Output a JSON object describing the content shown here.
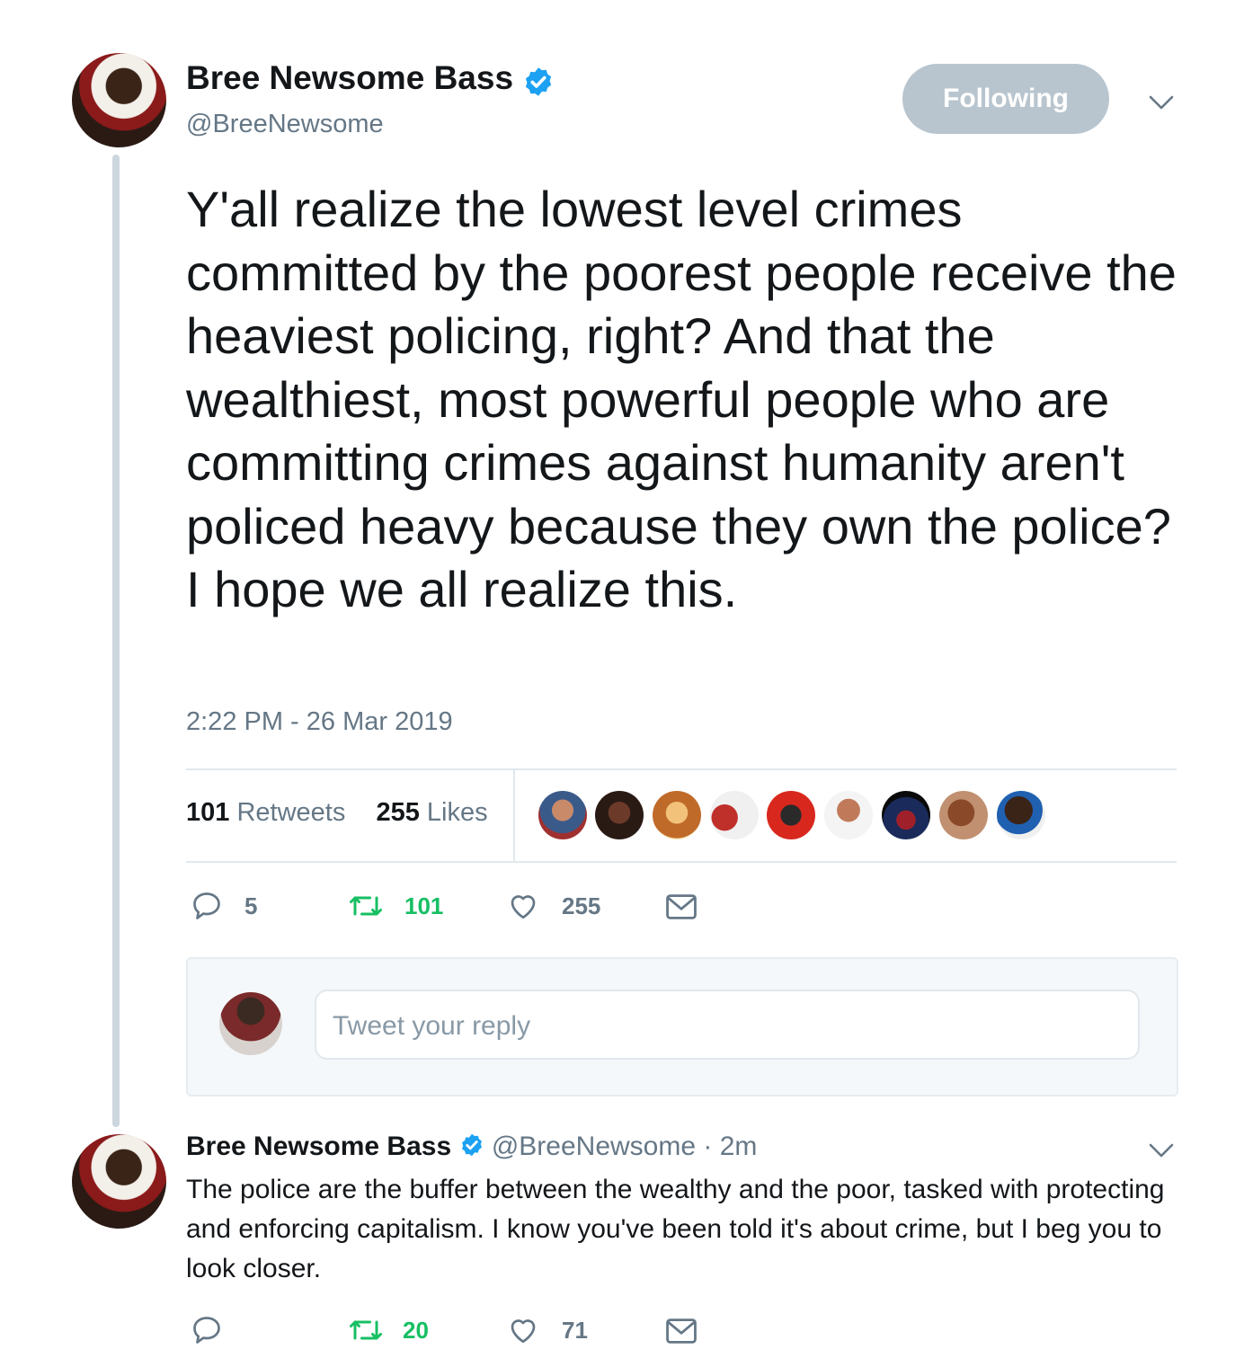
{
  "main_tweet": {
    "author_name": "Bree Newsome Bass",
    "author_handle": "@BreeNewsome",
    "follow_button": "Following",
    "text": "Y'all realize the lowest level crimes committed by the poorest people receive the heaviest policing, right? And that the wealthiest, most powerful people who are committing crimes against humanity aren't policed heavy because they own the police? I hope we all realize this.",
    "timestamp": "2:22 PM - 26 Mar 2019",
    "retweets_count": "101",
    "retweets_label": "Retweets",
    "likes_count": "255",
    "likes_label": "Likes",
    "actions": {
      "reply": "5",
      "retweet": "101",
      "like": "255"
    }
  },
  "reply_composer": {
    "placeholder": "Tweet your reply"
  },
  "reply_tweet": {
    "author_name": "Bree Newsome Bass",
    "author_handle": "@BreeNewsome",
    "time": "· 2m",
    "text": "The police are the buffer between the wealthy and the poor, tasked with protecting and enforcing capitalism. I know you've been told it's about crime, but I beg you to look closer.",
    "actions": {
      "retweet": "20",
      "like": "71"
    }
  },
  "colors": {
    "verified": "#1da1f2",
    "retweet_active": "#17bf63",
    "secondary_text": "#657786",
    "icon": "#657786",
    "follow_button_bg": "#b9c5ce"
  }
}
